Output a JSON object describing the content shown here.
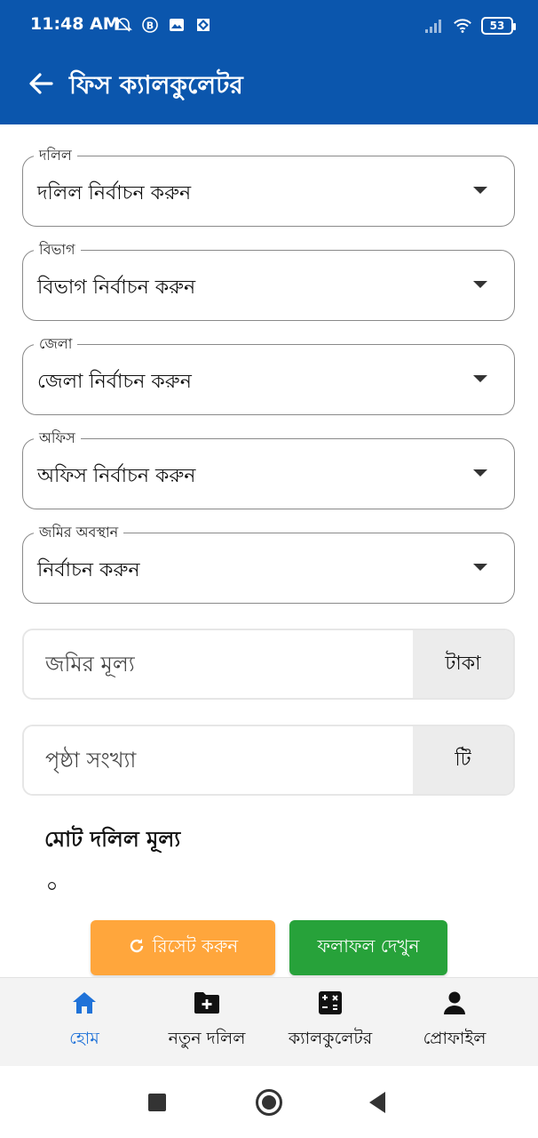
{
  "status_bar": {
    "time": "11:48 AM",
    "battery": "53"
  },
  "appbar": {
    "title": "ফিস ক্যালকুলেটর"
  },
  "form": {
    "dolil": {
      "label": "দলিল",
      "value": "দলিল নির্বাচন করুন"
    },
    "bibhag": {
      "label": "বিভাগ",
      "value": "বিভাগ নির্বাচন করুন"
    },
    "zila": {
      "label": "জেলা",
      "value": "জেলা নির্বাচন করুন"
    },
    "office": {
      "label": "অফিস",
      "value": "অফিস নির্বাচন করুন"
    },
    "land_location": {
      "label": "জমির অবস্থান",
      "value": "নির্বাচন করুন"
    },
    "land_value": {
      "placeholder": "জমির মূল্য",
      "addon": "টাকা"
    },
    "page_count": {
      "placeholder": "পৃষ্ঠা সংখ্যা",
      "addon": "টি"
    }
  },
  "total": {
    "title": "মোট দলিল মূল্য",
    "value": "০"
  },
  "buttons": {
    "reset": "রিসেট করুন",
    "result": "ফলাফল দেখুন"
  },
  "bottom_nav": [
    {
      "label": "হোম",
      "icon": "home-icon",
      "active": true
    },
    {
      "label": "নতুন দলিল",
      "icon": "folder-plus-icon",
      "active": false
    },
    {
      "label": "ক্যালকুলেটর",
      "icon": "calculator-icon",
      "active": false
    },
    {
      "label": "প্রোফাইল",
      "icon": "user-icon",
      "active": false
    }
  ],
  "colors": {
    "primary": "#0b56ad",
    "reset": "#ffa63c",
    "result": "#27a23a",
    "nav_active": "#1f72d8"
  }
}
